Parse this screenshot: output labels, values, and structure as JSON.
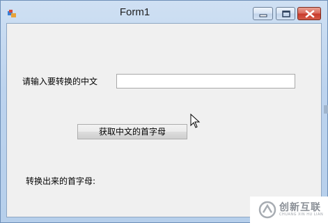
{
  "window": {
    "title": "Form1"
  },
  "form": {
    "input_label": "请输入要转换的中文",
    "input_value": "",
    "action_button": "获取中文的首字母",
    "result_label": "转换出来的首字母:"
  },
  "watermark": {
    "brand_cn": "创新互联",
    "brand_en": "CHUANG XIN HU LIAN"
  },
  "icons": [
    "app-icon",
    "minimize-icon",
    "maximize-icon",
    "close-icon",
    "mouse-cursor-icon",
    "brand-logo-icon"
  ],
  "colors": {
    "close_button": "#c83a2b",
    "client_background": "#f0f0f0",
    "titlebar": "#bcd3ee"
  }
}
